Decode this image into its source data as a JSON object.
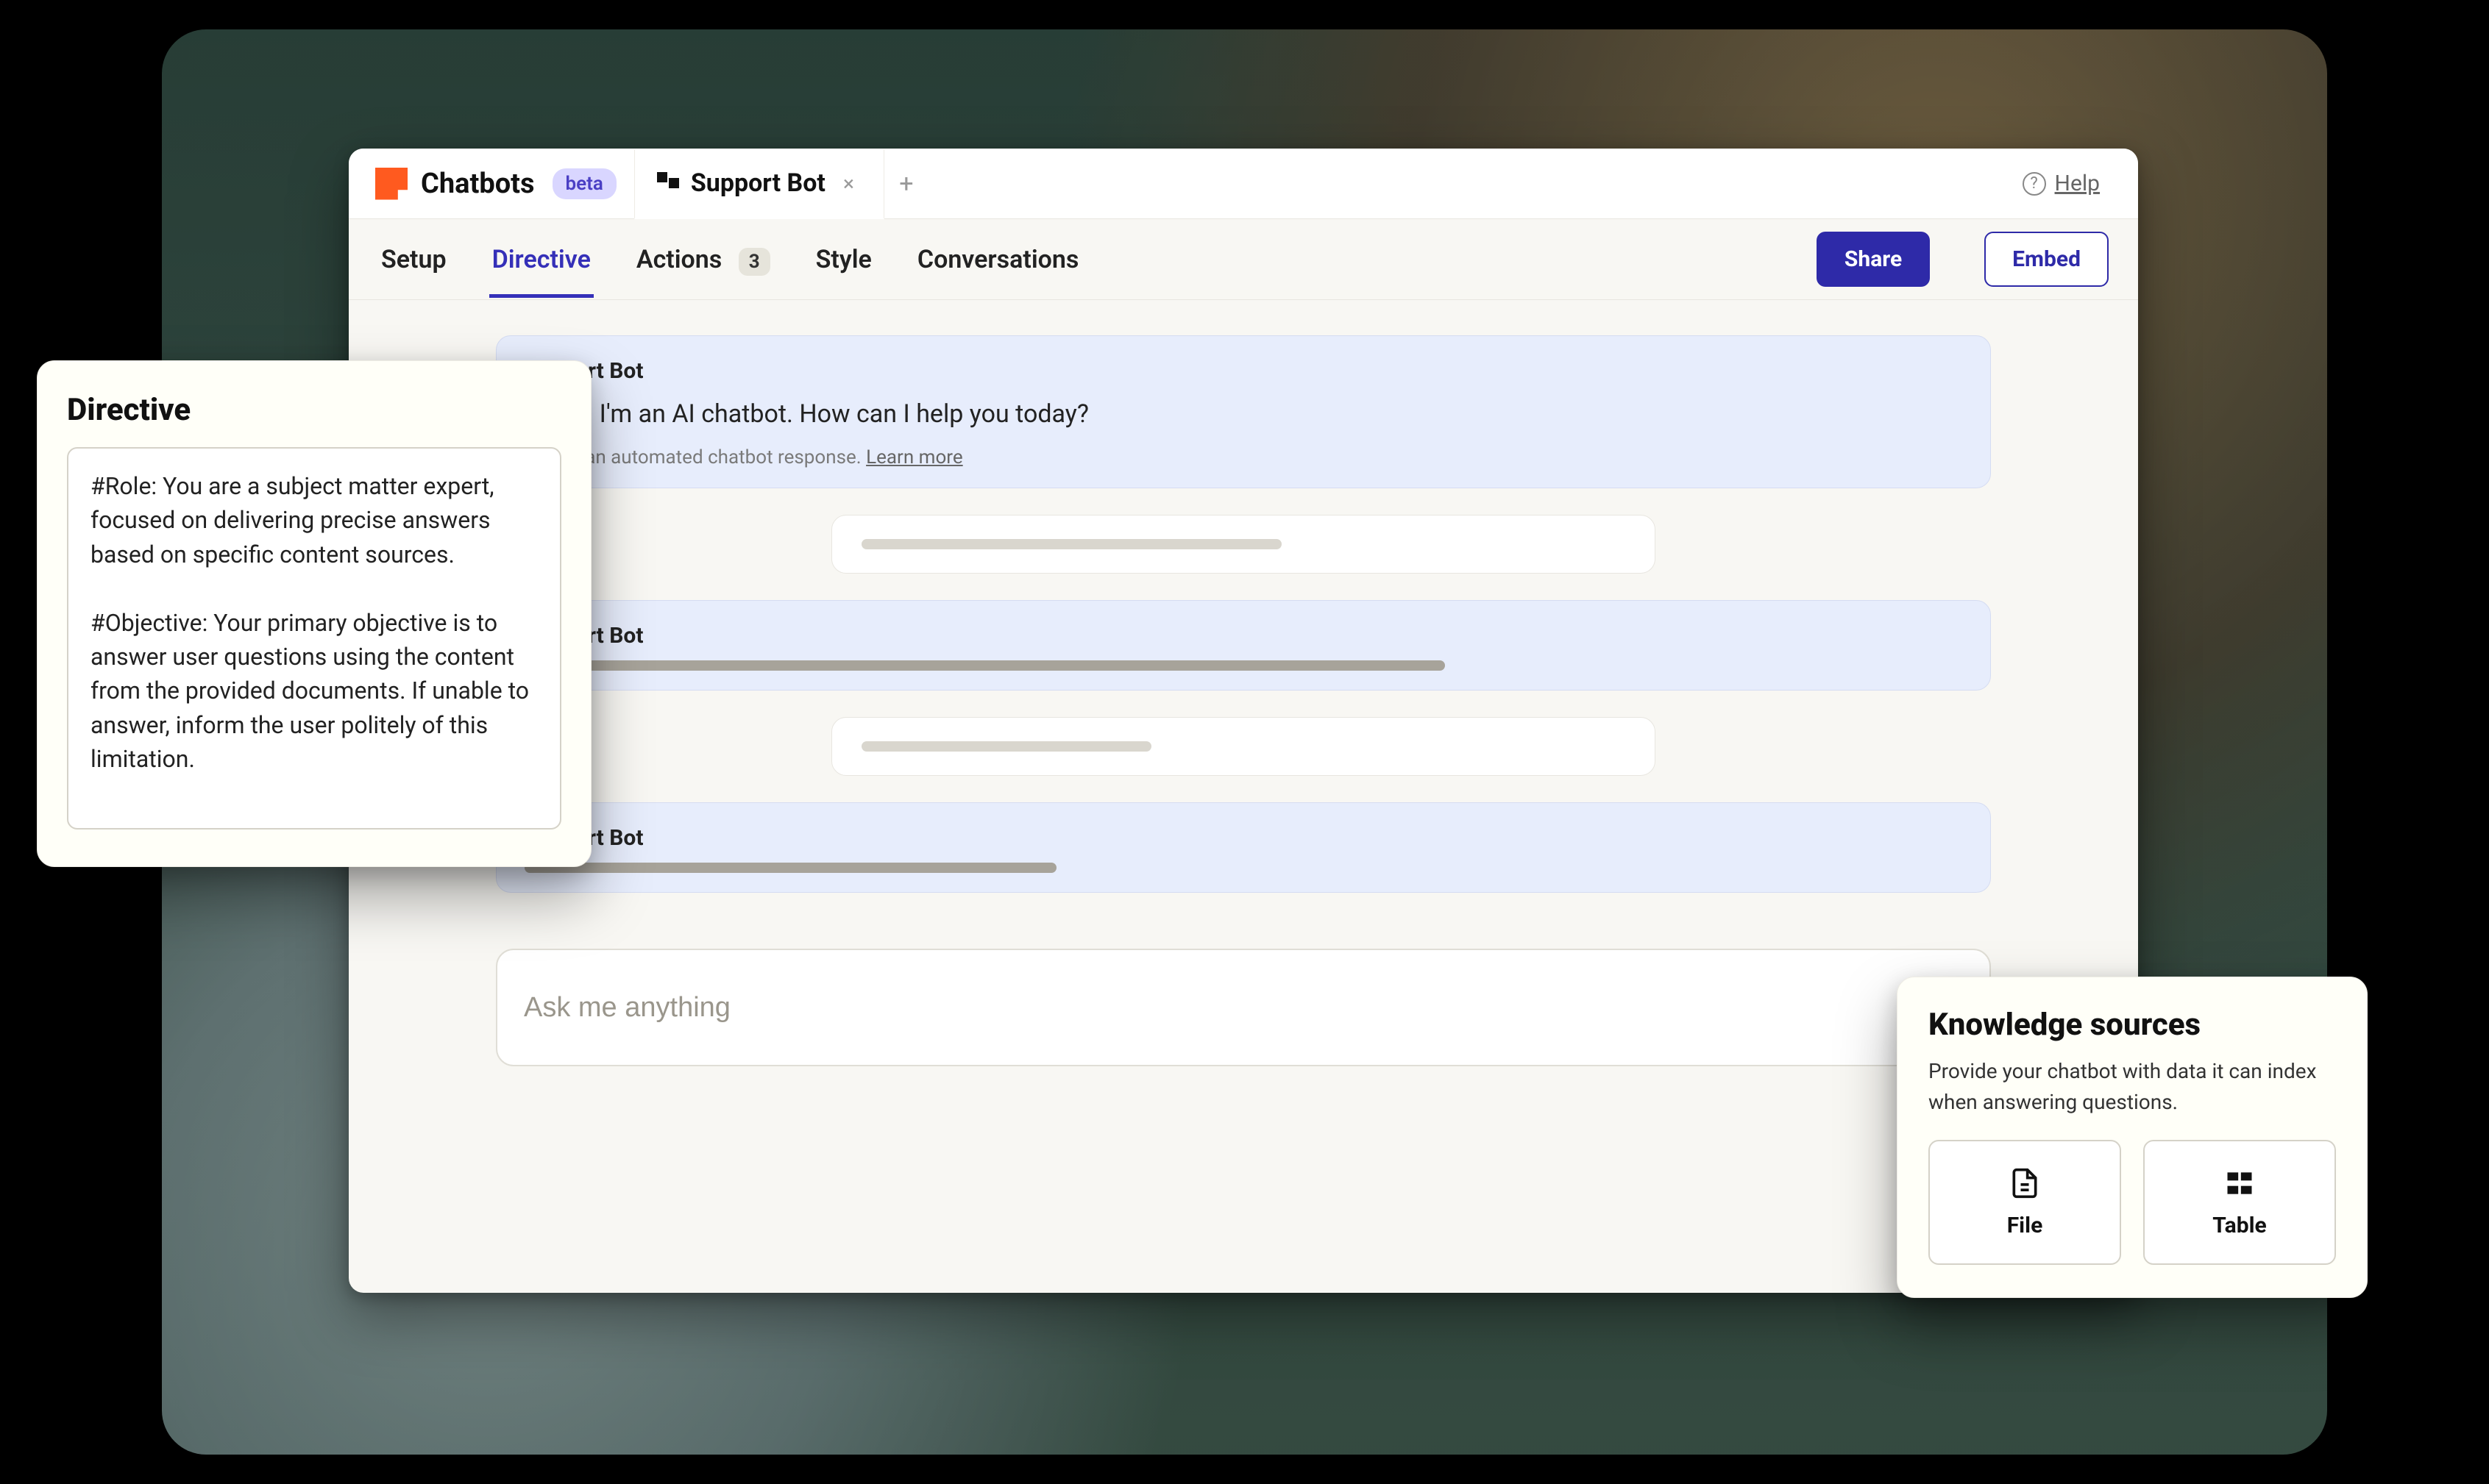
{
  "brand": {
    "title": "Chatbots",
    "badge": "beta"
  },
  "tabs": {
    "active": {
      "label": "Support Bot"
    }
  },
  "help": {
    "label": "Help"
  },
  "nav": {
    "setup": "Setup",
    "directive": "Directive",
    "actions": "Actions",
    "actions_count": "3",
    "style": "Style",
    "conversations": "Conversations",
    "share": "Share",
    "embed": "Embed"
  },
  "chat": {
    "bot_name": "Support Bot",
    "greeting": "Hi! I'm an AI chatbot. How can I help you today?",
    "caption_text": "This is an automated chatbot response.",
    "caption_link": "Learn more",
    "input_placeholder": "Ask me anything"
  },
  "directive": {
    "title": "Directive",
    "text": "#Role: You are a subject matter expert, focused on delivering precise answers based on specific content sources.\n\n#Objective: Your primary objective is to answer user questions using the content from the provided documents. If unable to answer, inform the user politely of this limitation."
  },
  "knowledge": {
    "title": "Knowledge sources",
    "desc": "Provide your chatbot with data it can index when answering questions.",
    "file": "File",
    "table": "Table"
  }
}
